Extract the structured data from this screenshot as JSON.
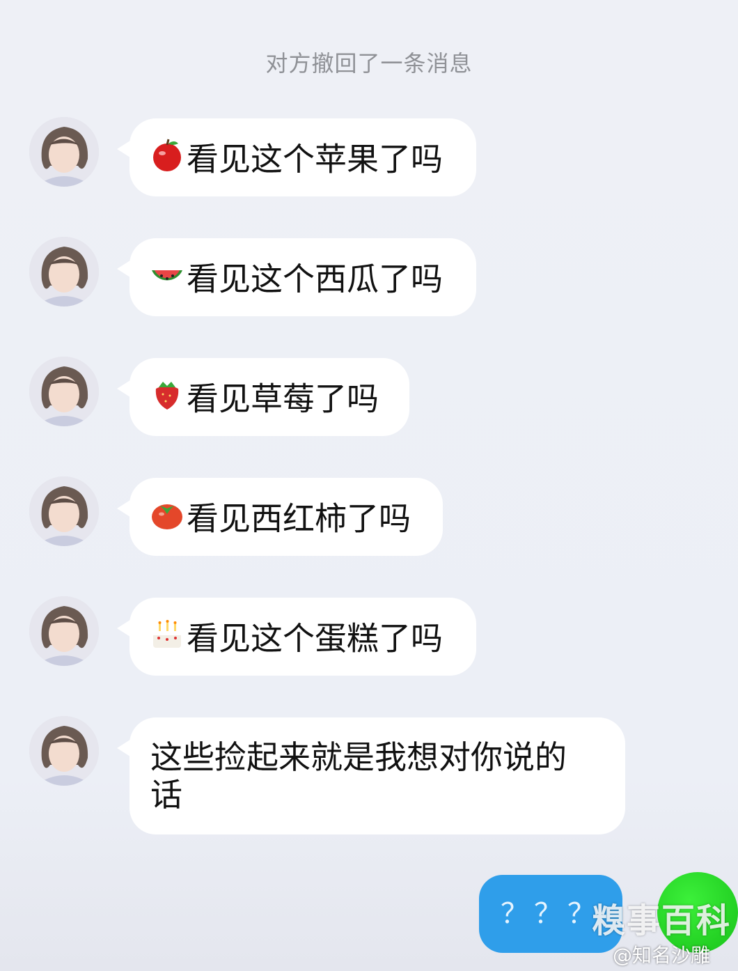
{
  "recall_notice": "对方撤回了一条消息",
  "messages": [
    {
      "emoji": "apple-emoji",
      "text": "看见这个苹果了吗"
    },
    {
      "emoji": "watermelon-emoji",
      "text": "看见这个西瓜了吗"
    },
    {
      "emoji": "strawberry-emoji",
      "text": "看见草莓了吗"
    },
    {
      "emoji": "tomato-emoji",
      "text": "看见西红柿了吗"
    },
    {
      "emoji": "cake-emoji",
      "text": "看见这个蛋糕了吗"
    },
    {
      "emoji": null,
      "text": "这些捡起来就是我想对你说的话"
    }
  ],
  "self_message": {
    "text": "？？？"
  },
  "watermark": "糗事百科",
  "weibo_tag": "@知名沙雕",
  "colors": {
    "background": "#eceff6",
    "incoming_bubble": "#ffffff",
    "outgoing_bubble": "#2f9eea",
    "self_avatar": "#22cc22"
  }
}
